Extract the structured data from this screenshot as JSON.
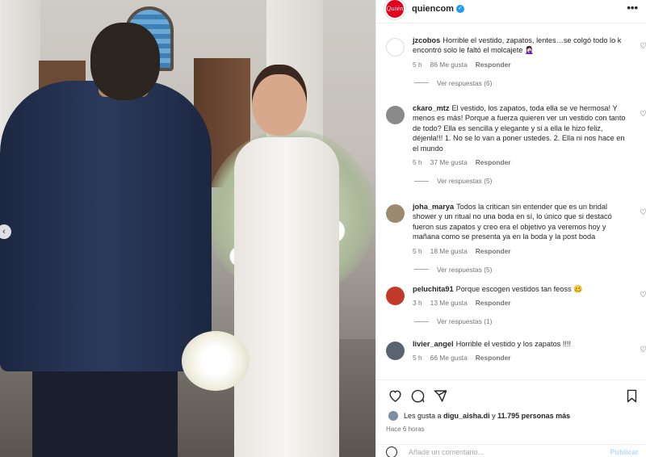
{
  "post": {
    "username": "quiencom",
    "avatar_text": "Quién",
    "more_label": "•••"
  },
  "photo": {
    "prev_arrow": "‹"
  },
  "comments": [
    {
      "user": "jzcobos",
      "text": "Horrible el vestido, zapatos, lentes…se colgó todo lo k encontró solo le faltó el molcajete 🤦🏻‍♀️",
      "age": "5 h",
      "likes": "86 Me gusta",
      "reply": "Responder",
      "replies": "Ver respuestas (6)",
      "avatar_color": "#ffffff"
    },
    {
      "user": "ckaro_mtz",
      "text": "El vestido, los zapatos, toda ella se ve hermosa! Y menos es más! Porque a fuerza quieren ver un vestido con tanto de todo? Ella es sencilla y elegante y si a ella le hizo feliz, déjenla!!! 1. No se lo van a poner ustedes. 2. Ella ni nos hace en el mundo",
      "age": "5 h",
      "likes": "37 Me gusta",
      "reply": "Responder",
      "replies": "Ver respuestas (5)",
      "avatar_color": "#8a8a8a"
    },
    {
      "user": "joha_marya",
      "text": "Todos la critican sin entender que es un bridal shower y un ritual no una boda en sí, lo único que si destacó fueron sus zapatos y creo era el objetivo ya veremos hoy y mañana como se presenta ya en la boda y la post boda",
      "age": "5 h",
      "likes": "18 Me gusta",
      "reply": "Responder",
      "replies": "Ver respuestas (5)",
      "avatar_color": "#9c8a6e"
    },
    {
      "user": "peluchita91",
      "text": "Porque escogen vestidos tan feoss 🥴",
      "age": "3 h",
      "likes": "13 Me gusta",
      "reply": "Responder",
      "replies": "Ver respuestas (1)",
      "avatar_color": "#c0392b"
    },
    {
      "user": "livier_angel",
      "text": "Horrible el vestido y los zapatos !!!!",
      "age": "5 h",
      "likes": "66 Me gusta",
      "reply": "Responder",
      "replies": "",
      "avatar_color": "#5a6470"
    }
  ],
  "likes_line": {
    "prefix": "Les gusta a",
    "user": "digu_aisha.di",
    "middle": "y",
    "count": "11.795 personas más"
  },
  "posted": "Hace 6 horas",
  "add_comment": {
    "placeholder": "Añade un comentario...",
    "publish": "Publicar"
  },
  "colors": {
    "brand_red": "#e0001b",
    "verified_blue": "#1d9bf0",
    "publish_disabled": "#b3dbff"
  }
}
